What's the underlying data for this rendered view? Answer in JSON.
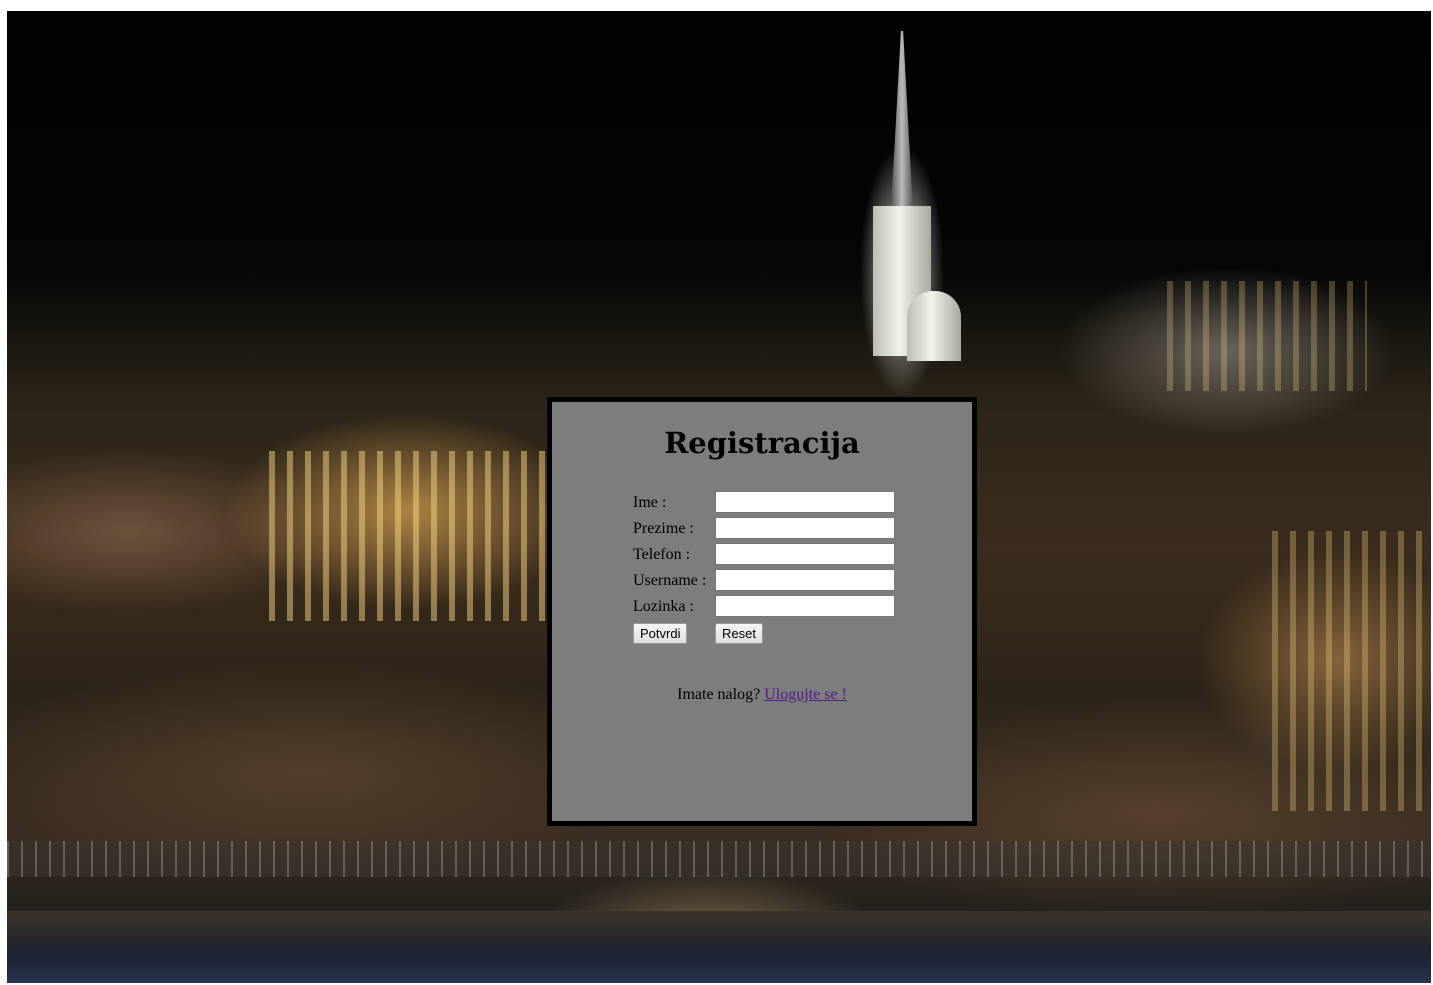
{
  "form": {
    "title": "Registracija",
    "fields": [
      {
        "label": "Ime :",
        "value": ""
      },
      {
        "label": "Prezime :",
        "value": ""
      },
      {
        "label": "Telefon :",
        "value": ""
      },
      {
        "label": "Username :",
        "value": ""
      },
      {
        "label": "Lozinka :",
        "value": ""
      }
    ],
    "submit_label": "Potvrdi",
    "reset_label": "Reset"
  },
  "login_prompt": {
    "text": "Imate nalog?",
    "link_text": "Ulogujte se !"
  },
  "colors": {
    "panel_bg": "#7d7d7d",
    "panel_border": "#000000",
    "link": "#551a8b"
  }
}
